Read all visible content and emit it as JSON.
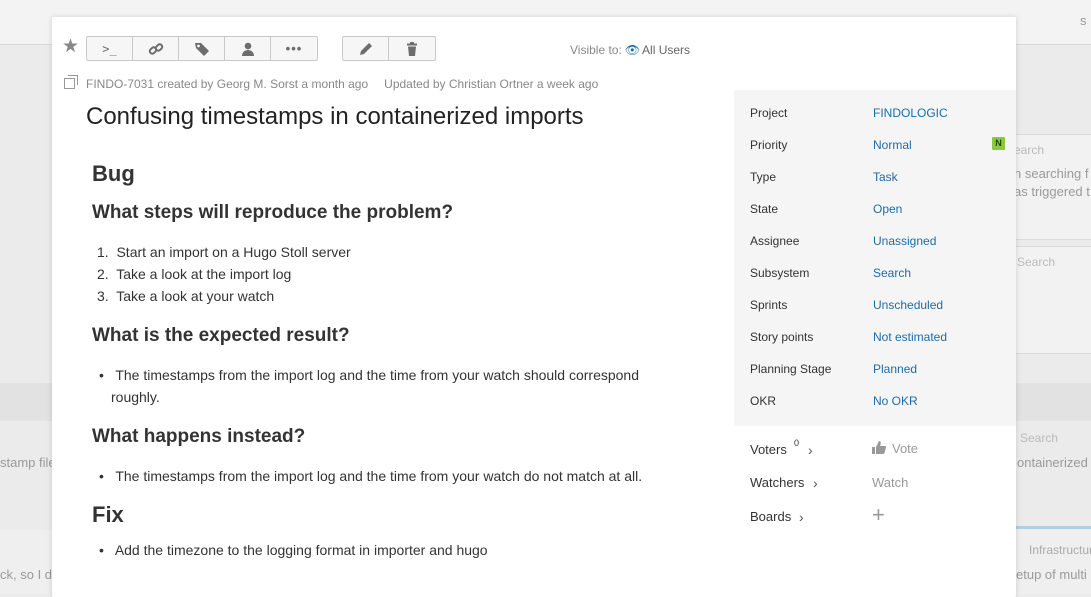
{
  "background": {
    "top_right_letter": "s",
    "search1": "earch",
    "snippet1": "n searching f",
    "snippet2": "as triggered t",
    "search2": "Search",
    "search3": "Search",
    "snippet3": "ontainerized",
    "left1": "stamp file",
    "infra": "Infrastructur",
    "left2": "ck, so I d",
    "snippet4": "etup of multi i"
  },
  "toolbar": {
    "buttons": [
      {
        "icon": "command-icon"
      },
      {
        "icon": "link-icon"
      },
      {
        "icon": "tag-icon"
      },
      {
        "icon": "user-icon"
      },
      {
        "icon": "more-icon"
      }
    ],
    "edit_icon": "edit-icon",
    "delete_icon": "delete-icon",
    "visible_label": "Visible to:",
    "visible_value": "All Users"
  },
  "issue": {
    "id": "FINDO-7031",
    "created_by": "created by Georg M. Sorst a month ago",
    "updated_by": "Updated by Christian Ortner a week ago",
    "title": "Confusing timestamps in containerized imports"
  },
  "description": {
    "h_bug": "Bug",
    "h_steps": "What steps will reproduce the problem?",
    "steps": [
      "Start an import on a Hugo Stoll server",
      "Take a look at the import log",
      "Take a look at your watch"
    ],
    "h_expected": "What is the expected result?",
    "expected_line1": "The timestamps from the import log and the time from your watch should correspond",
    "expected_line2": "roughly.",
    "h_instead": "What happens instead?",
    "instead": "The timestamps from the import log and the time from your watch do not match at all.",
    "h_fix": "Fix",
    "fix": "Add the timezone to the logging format in importer and hugo"
  },
  "fields": [
    {
      "label": "Project",
      "value": "FINDOLOGIC"
    },
    {
      "label": "Priority",
      "value": "Normal",
      "badge": "N"
    },
    {
      "label": "Type",
      "value": "Task"
    },
    {
      "label": "State",
      "value": "Open"
    },
    {
      "label": "Assignee",
      "value": "Unassigned"
    },
    {
      "label": "Subsystem",
      "value": "Search"
    },
    {
      "label": "Sprints",
      "value": "Unscheduled"
    },
    {
      "label": "Story points",
      "value": "Not estimated"
    },
    {
      "label": "Planning Stage",
      "value": "Planned"
    },
    {
      "label": "OKR",
      "value": "No OKR"
    }
  ],
  "voters": {
    "label": "Voters",
    "count": "0",
    "action": "Vote"
  },
  "watchers": {
    "label": "Watchers",
    "action": "Watch"
  },
  "boards": {
    "label": "Boards"
  }
}
